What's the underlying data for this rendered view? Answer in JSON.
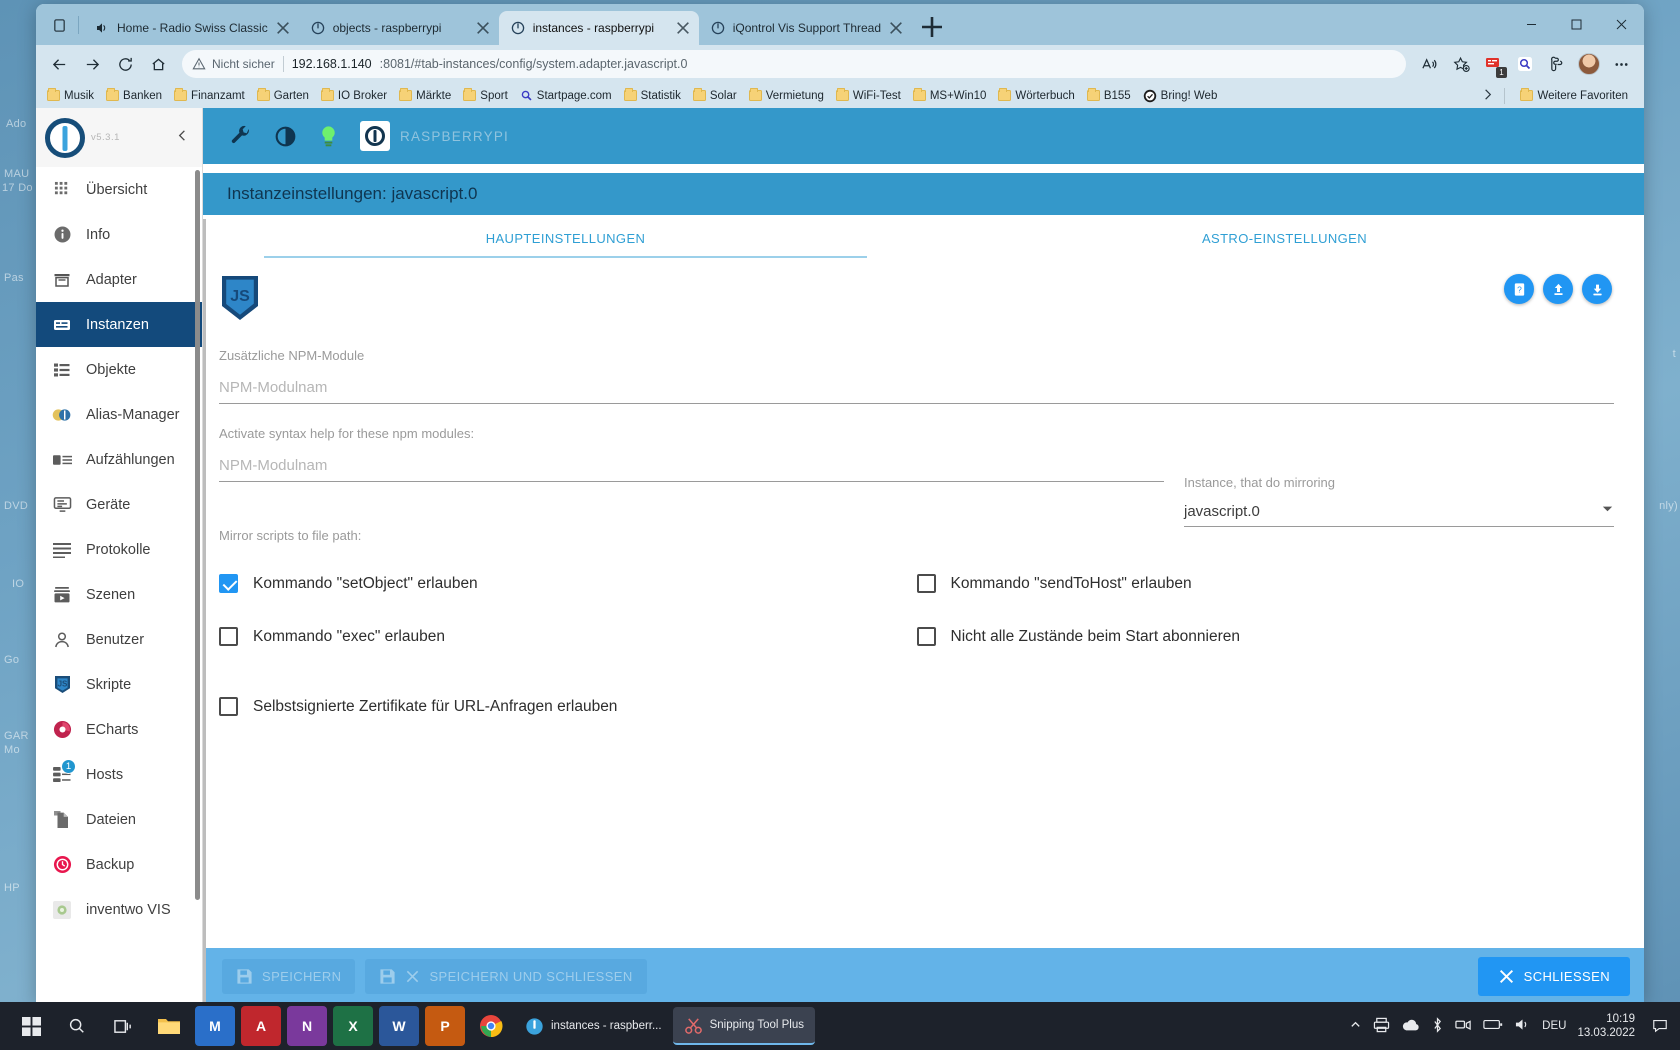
{
  "desktop": {
    "left_texts": [
      "Ado",
      "MAU",
      "17 Do",
      "Pas",
      "DVD",
      "IO",
      "Go",
      "GAR",
      "Mo",
      "HP"
    ],
    "right_texts": [
      "t",
      "nly)"
    ]
  },
  "browser": {
    "tabs": [
      {
        "title": "Home - Radio Swiss Classic",
        "icon": "speaker-icon",
        "active": false
      },
      {
        "title": "objects - raspberrypi",
        "icon": "iobroker-icon",
        "active": false
      },
      {
        "title": "instances - raspberrypi",
        "icon": "iobroker-icon",
        "active": true
      },
      {
        "title": "iQontrol Vis Support Thread",
        "icon": "iobroker-icon",
        "active": false
      }
    ],
    "new_tab_label": "+",
    "toolbar": {
      "back": "back-arrow",
      "forward": "forward-arrow",
      "reload": "reload",
      "home": "home",
      "security_label": "Nicht sicher",
      "url_host": "192.168.1.140",
      "url_rest": ":8081/#tab-instances/config/system.adapter.javascript.0",
      "read_aloud": "read-aloud",
      "add_favorite": "add-favorite",
      "extension_badge": "1",
      "search_ext": "search-extension",
      "collections": "collections",
      "settings_more": "more"
    },
    "bookmarks": [
      {
        "label": "Musik",
        "icon": "folder"
      },
      {
        "label": "Banken",
        "icon": "folder"
      },
      {
        "label": "Finanzamt",
        "icon": "folder"
      },
      {
        "label": "Garten",
        "icon": "folder"
      },
      {
        "label": "IO Broker",
        "icon": "folder"
      },
      {
        "label": "Märkte",
        "icon": "folder"
      },
      {
        "label": "Sport",
        "icon": "folder"
      },
      {
        "label": "Startpage.com",
        "icon": "search"
      },
      {
        "label": "Statistik",
        "icon": "folder"
      },
      {
        "label": "Solar",
        "icon": "folder"
      },
      {
        "label": "Vermietung",
        "icon": "folder"
      },
      {
        "label": "WiFi-Test",
        "icon": "folder"
      },
      {
        "label": "MS+Win10",
        "icon": "folder"
      },
      {
        "label": "Wörterbuch",
        "icon": "folder"
      },
      {
        "label": "B155",
        "icon": "folder"
      },
      {
        "label": "Bring! Web",
        "icon": "bring"
      }
    ],
    "bookmarks_more": "Weitere Favoriten"
  },
  "app": {
    "version": "v5.3.1",
    "host_name": "RASPBERRYPI",
    "appbar_icons": [
      "wrench-icon",
      "contrast-icon",
      "bulb-icon"
    ],
    "sidebar": [
      {
        "label": "Übersicht",
        "icon": "grid-icon",
        "selected": false
      },
      {
        "label": "Info",
        "icon": "info-icon",
        "selected": false
      },
      {
        "label": "Adapter",
        "icon": "store-icon",
        "selected": false
      },
      {
        "label": "Instanzen",
        "icon": "instances-icon",
        "selected": true
      },
      {
        "label": "Objekte",
        "icon": "list-icon",
        "selected": false
      },
      {
        "label": "Alias-Manager",
        "icon": "alias-icon",
        "selected": false
      },
      {
        "label": "Aufzählungen",
        "icon": "enum-icon",
        "selected": false
      },
      {
        "label": "Geräte",
        "icon": "devices-icon",
        "selected": false
      },
      {
        "label": "Protokolle",
        "icon": "logs-icon",
        "selected": false
      },
      {
        "label": "Szenen",
        "icon": "scenes-icon",
        "selected": false
      },
      {
        "label": "Benutzer",
        "icon": "user-icon",
        "selected": false
      },
      {
        "label": "Skripte",
        "icon": "js-icon",
        "selected": false
      },
      {
        "label": "ECharts",
        "icon": "echarts-icon",
        "selected": false
      },
      {
        "label": "Hosts",
        "icon": "hosts-icon",
        "selected": false,
        "badge": "1"
      },
      {
        "label": "Dateien",
        "icon": "files-icon",
        "selected": false
      },
      {
        "label": "Backup",
        "icon": "backup-icon",
        "selected": false
      },
      {
        "label": "inventwo VIS",
        "icon": "inventwo-icon",
        "selected": false
      }
    ],
    "page_title": "Instanzeinstellungen: javascript.0",
    "tabs": [
      {
        "label": "HAUPTEINSTELLUNGEN",
        "active": true
      },
      {
        "label": "ASTRO-EINSTELLUNGEN",
        "active": false
      }
    ],
    "icon_buttons": [
      {
        "name": "help-button",
        "glyph": "?"
      },
      {
        "name": "upload-button",
        "glyph": "↥"
      },
      {
        "name": "download-button",
        "glyph": "↧"
      }
    ],
    "form": {
      "npm_modules_label": "Zusätzliche NPM-Module",
      "npm_modules_placeholder": "NPM-Modulnam",
      "npm_modules_value": "",
      "syntax_help_label": "Activate syntax help for these npm modules:",
      "syntax_help_placeholder": "NPM-Modulnam",
      "syntax_help_value": "",
      "mirror_instance_label": "Instance, that do mirroring",
      "mirror_instance_value": "javascript.0",
      "mirror_path_label": "Mirror scripts to file path:",
      "mirror_path_value": "",
      "checkboxes": [
        {
          "label": "Kommando \"setObject\" erlauben",
          "checked": true
        },
        {
          "label": "Kommando \"sendToHost\" erlauben",
          "checked": false
        },
        {
          "label": "Kommando \"exec\" erlauben",
          "checked": false
        },
        {
          "label": "Nicht alle Zustände beim Start abonnieren",
          "checked": false
        },
        {
          "label": "Selbstsignierte Zertifikate für URL-Anfragen erlauben",
          "checked": false
        }
      ]
    },
    "footer": {
      "save": "SPEICHERN",
      "save_close": "SPEICHERN UND SCHLIESSEN",
      "close": "SCHLIESSEN"
    }
  },
  "taskbar": {
    "start": "start-icon",
    "search": "search-icon",
    "taskview": "taskview-icon",
    "pinned": [
      "explorer",
      "store",
      "word-alt",
      "onenote",
      "excel",
      "word",
      "powerpoint",
      "chrome"
    ],
    "windows": [
      {
        "title": "instances - raspberr...",
        "active": false
      },
      {
        "title": "Snipping Tool Plus",
        "active": true
      }
    ],
    "language": "DEU",
    "time": "10:19",
    "date": "13.03.2022"
  }
}
